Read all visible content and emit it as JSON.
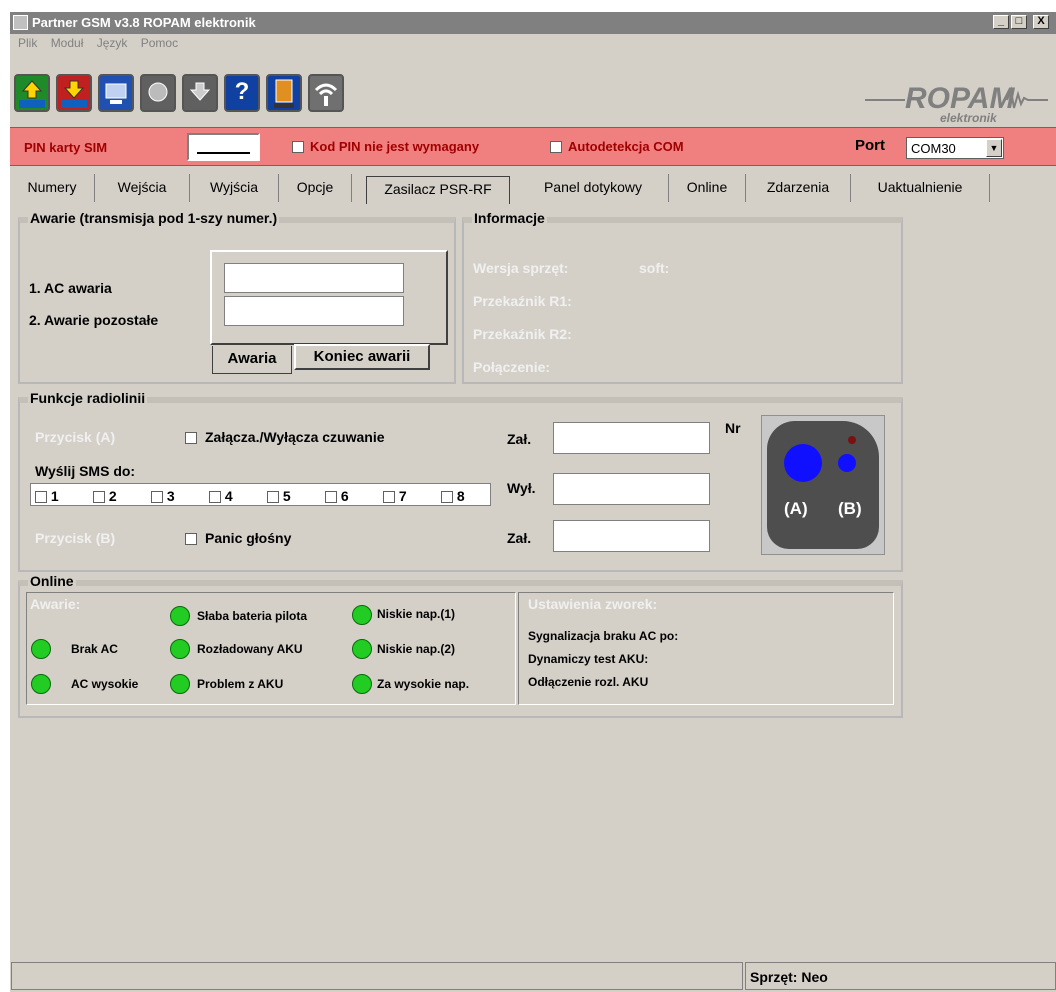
{
  "window": {
    "title": "Partner GSM v3.8 ROPAM elektronik",
    "min": "_",
    "max": "□",
    "close": "X"
  },
  "menu": [
    "Plik",
    "Moduł",
    "Język",
    "Pomoc"
  ],
  "toolbar": {
    "buttons": [
      {
        "name": "upload-rpm",
        "label": ".rpm",
        "color": "#1f8a2a"
      },
      {
        "name": "download-rpm",
        "label": ".rpm",
        "color": "#c02020"
      },
      {
        "name": "connect",
        "label": "",
        "color": "#2050b0"
      },
      {
        "name": "module",
        "label": "",
        "color": "#606060"
      },
      {
        "name": "save",
        "label": "",
        "color": "#606060"
      },
      {
        "name": "help",
        "label": "?",
        "color": "#1040a0"
      },
      {
        "name": "exit",
        "label": "EXIT",
        "color": "#1040a0"
      },
      {
        "name": "wireless",
        "label": "",
        "color": "#707070"
      }
    ],
    "logo_text": "ROPAM",
    "logo_sub": "elektronik"
  },
  "pinbar": {
    "pin_label": "PIN karty SIM",
    "pin_value": "",
    "no_pin_label": "Kod PIN nie jest wymagany",
    "autodetect_label": "Autodetekcja COM",
    "port_label": "Port",
    "port_value": "COM30"
  },
  "tabs": [
    "Numery",
    "Wejścia",
    "Wyjścia",
    "Opcje",
    "Zasilacz PSR-RF",
    "Panel dotykowy",
    "Online",
    "Zdarzenia",
    "Uaktualnienie"
  ],
  "awarie": {
    "title": "Awarie (transmisja pod 1-szy numer.)",
    "ac_label": "1. AC awaria",
    "other_label": "2. Awarie pozostałe",
    "ac_value": "",
    "other_value": "",
    "tab_awaria": "Awaria",
    "tab_koniec": "Koniec awarii"
  },
  "informacje": {
    "title": "Informacje",
    "wersja": "Wersja sprzęt:",
    "soft": "soft:",
    "r1": "Przekaźnik R1:",
    "r2": "Przekaźnik R2:",
    "polaczenie": "Połączenie:"
  },
  "radio": {
    "title": "Funkcje radiolinii",
    "btn_a": "Przycisk (A)",
    "arm_label": "Załącza./Wyłącza czuwanie",
    "sms_label": "Wyślij SMS do:",
    "numbers": [
      "1",
      "2",
      "3",
      "4",
      "5",
      "6",
      "7",
      "8"
    ],
    "btn_b": "Przycisk (B)",
    "panic_label": "Panic głośny",
    "zal1": "Zał.",
    "wyl": "Wył.",
    "zal2": "Zał.",
    "nr": "Nr",
    "remote_a": "(A)",
    "remote_b": "(B)"
  },
  "online": {
    "title": "Online",
    "awarie_label": "Awarie:",
    "leds": {
      "brak_ac": "Brak AC",
      "ac_wysokie": "AC wysokie",
      "slaba_bateria": "Słaba bateria pilota",
      "rozladowany": "Rozładowany AKU",
      "problem": "Problem z AKU",
      "niskie1": "Niskie nap.(1)",
      "niskie2": "Niskie nap.(2)",
      "za_wysokie": "Za wysokie nap."
    },
    "led_color": "#22cc22",
    "zworki_title": "Ustawienia zworek:",
    "sygn": "Sygnalizacja braku AC po:",
    "dyn": "Dynamiczy test AKU:",
    "odl": "Odłączenie rozl. AKU"
  },
  "status": {
    "left": "",
    "right": "Sprzęt: Neo"
  }
}
